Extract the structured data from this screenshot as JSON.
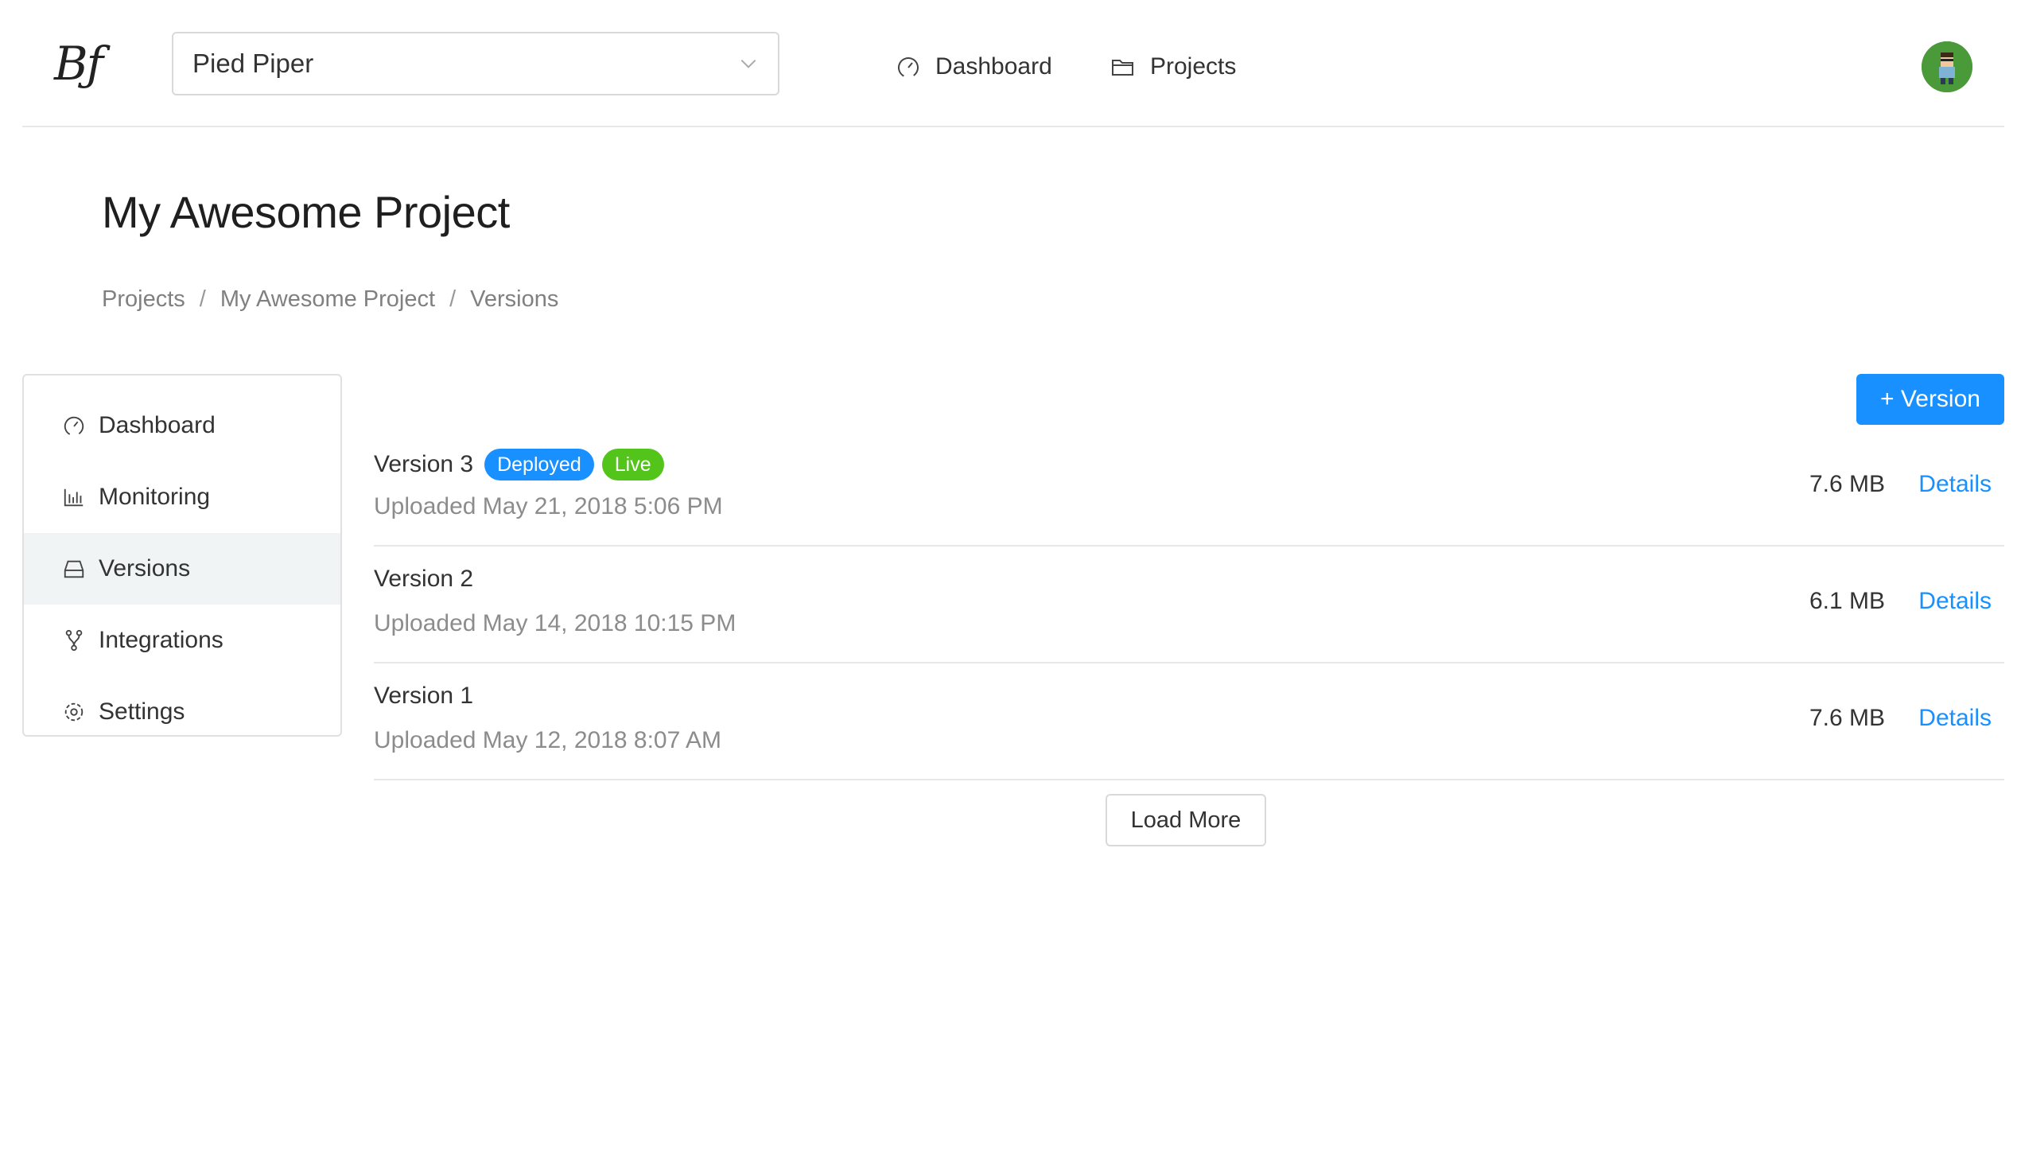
{
  "header": {
    "logo": "Bƒ",
    "org_select": {
      "value": "Pied Piper"
    },
    "nav": {
      "dashboard": "Dashboard",
      "projects": "Projects"
    }
  },
  "page": {
    "title": "My Awesome Project",
    "breadcrumb": [
      "Projects",
      "My Awesome Project",
      "Versions"
    ],
    "breadcrumb_sep": "/"
  },
  "sidebar": {
    "items": [
      {
        "label": "Dashboard",
        "icon": "dashboard-icon"
      },
      {
        "label": "Monitoring",
        "icon": "bar-chart-icon"
      },
      {
        "label": "Versions",
        "icon": "inbox-icon",
        "active": true
      },
      {
        "label": "Integrations",
        "icon": "fork-icon"
      },
      {
        "label": "Settings",
        "icon": "gear-icon"
      }
    ]
  },
  "actions": {
    "add_version": "+ Version",
    "load_more": "Load More"
  },
  "versions": [
    {
      "name": "Version 3",
      "badges": [
        "Deployed",
        "Live"
      ],
      "uploaded": "Uploaded May 21, 2018 5:06 PM",
      "size": "7.6 MB",
      "details": "Details"
    },
    {
      "name": "Version 2",
      "uploaded": "Uploaded May 14, 2018 10:15 PM",
      "size": "6.1 MB",
      "details": "Details"
    },
    {
      "name": "Version 1",
      "uploaded": "Uploaded May 12, 2018 8:07 AM",
      "size": "7.6 MB",
      "details": "Details"
    }
  ],
  "colors": {
    "primary": "#1890ff",
    "live": "#52c41a",
    "active_bg": "#f0f4f4"
  }
}
